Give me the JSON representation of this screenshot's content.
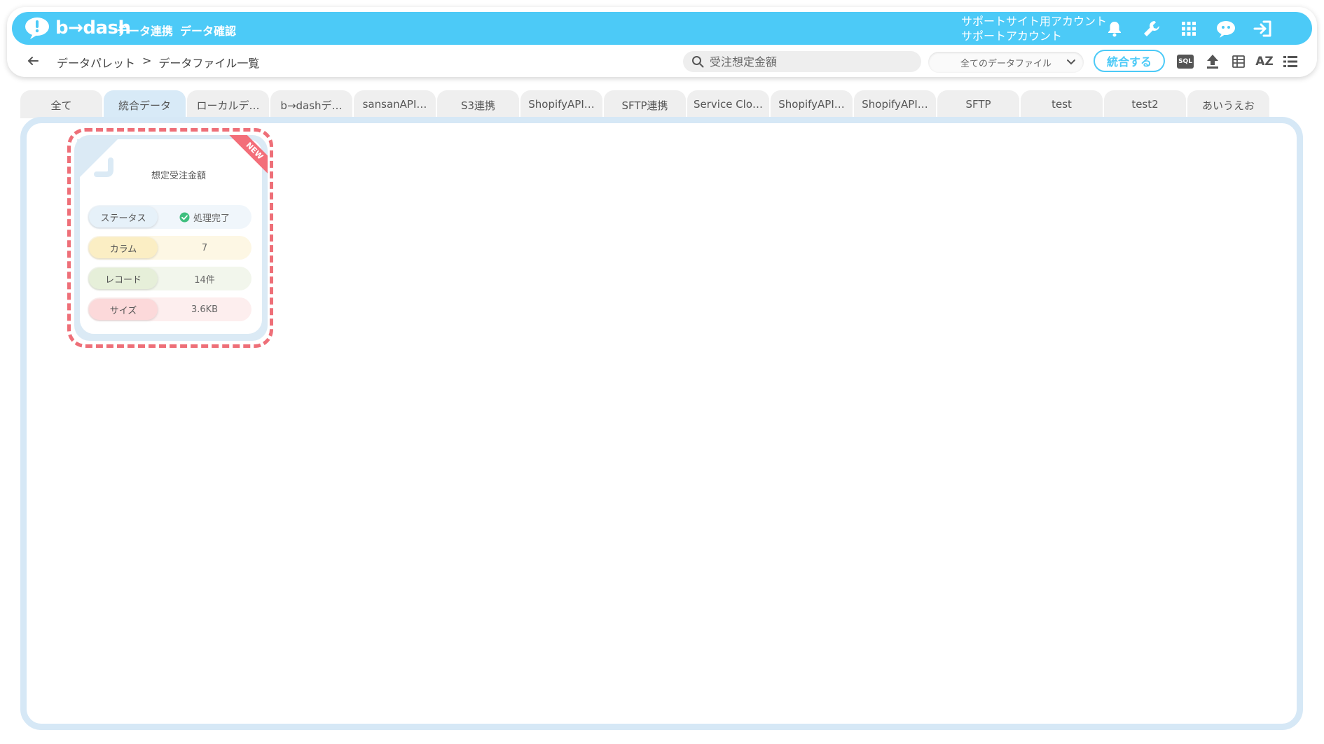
{
  "header": {
    "logo_text": "b→dash",
    "nav": [
      "データ連携",
      "データ確認"
    ],
    "account_line1": "サポートサイト用アカウント",
    "account_line2": "サポートアカウント",
    "icons": [
      "bell-icon",
      "wrench-icon",
      "apps-grid-icon",
      "chat-robot-icon",
      "logout-icon"
    ]
  },
  "subbar": {
    "breadcrumb": [
      "データパレット",
      ">",
      "データファイル一覧"
    ],
    "search_placeholder": "受注想定金額",
    "filter_value": "全てのデータファイル",
    "merge_button": "統合する",
    "tools": [
      "sql-icon",
      "upload-icon",
      "table-view-icon",
      "sort-az-icon",
      "list-view-icon"
    ],
    "sql_label": "SQL",
    "az_label": "AZ"
  },
  "tabs": [
    "全て",
    "統合データ",
    "ローカルデ…",
    "b→dashデ…",
    "sansanAPI…",
    "S3連携",
    "ShopifyAPI…",
    "SFTP連携",
    "Service Clo…",
    "ShopifyAPI…",
    "ShopifyAPI…",
    "SFTP",
    "test",
    "test2",
    "あいうえお"
  ],
  "active_tab": "統合データ",
  "file_card": {
    "title": "想定受注金額",
    "badge": "NEW",
    "rows": [
      {
        "label": "ステータス",
        "value": "処理完了",
        "color": "#e6f1f9",
        "bg": "#f0f6fb"
      },
      {
        "label": "カラム",
        "value": "7",
        "color": "#fbeec4",
        "bg": "#fdf7e4"
      },
      {
        "label": "レコード",
        "value": "14件",
        "color": "#e6efd9",
        "bg": "#f2f6ec"
      },
      {
        "label": "サイズ",
        "value": "3.6KB",
        "color": "#fcd9da",
        "bg": "#fdeeee"
      }
    ]
  },
  "colors": {
    "brand": "#4ccaf7",
    "highlight": "#ee6f78",
    "status_ok": "#3fbf7f"
  }
}
